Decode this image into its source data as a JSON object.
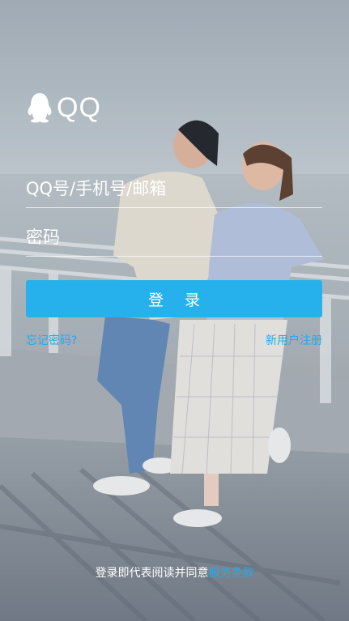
{
  "app": {
    "logo_text": "QQ"
  },
  "login_form": {
    "account_placeholder": "QQ号/手机号/邮箱",
    "password_placeholder": "密码",
    "login_label": "登 录",
    "forgot_password_label": "忘记密码?",
    "register_label": "新用户注册"
  },
  "footer": {
    "agreement_prefix": "登录即代表阅读并同意",
    "terms_label": "服务条款"
  },
  "colors": {
    "accent": "#27b1ec",
    "link": "#2aa8e8",
    "text_on_photo": "#ffffff"
  },
  "icons": {
    "logo": "qq-penguin-icon"
  }
}
